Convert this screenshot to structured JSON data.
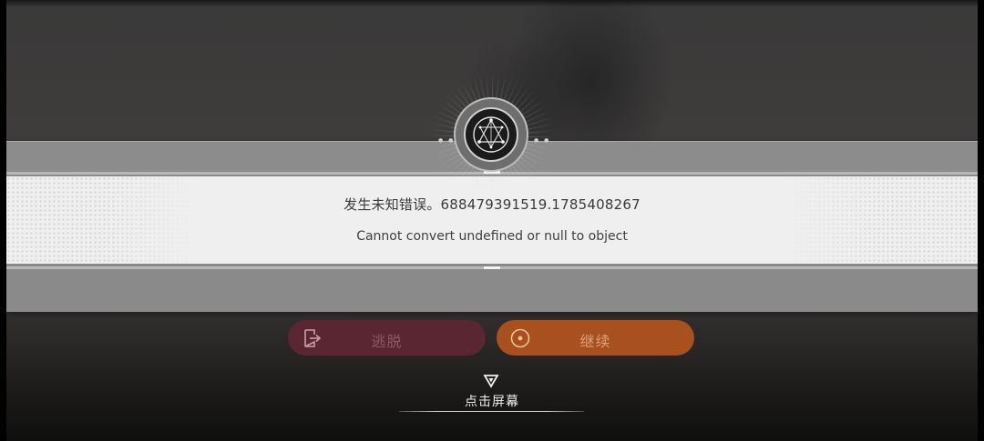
{
  "dialog": {
    "error_title": "发生未知错误。688479391519.1785408267",
    "error_detail": "Cannot convert undefined or null to object",
    "emblem_icon": "constellation-emblem-icon"
  },
  "buttons": {
    "escape_label": "逃脱",
    "escape_icon": "exit-door-icon",
    "continue_label": "继续",
    "continue_icon": "circle-dot-icon"
  },
  "prompt": {
    "tap_text": "点击屏幕",
    "tap_icon": "down-triangle-icon"
  },
  "colors": {
    "escape_button": "#5a2632",
    "continue_button": "#a8511f",
    "panel_white": "#efefef",
    "panel_grey": "#8c8c8c"
  }
}
